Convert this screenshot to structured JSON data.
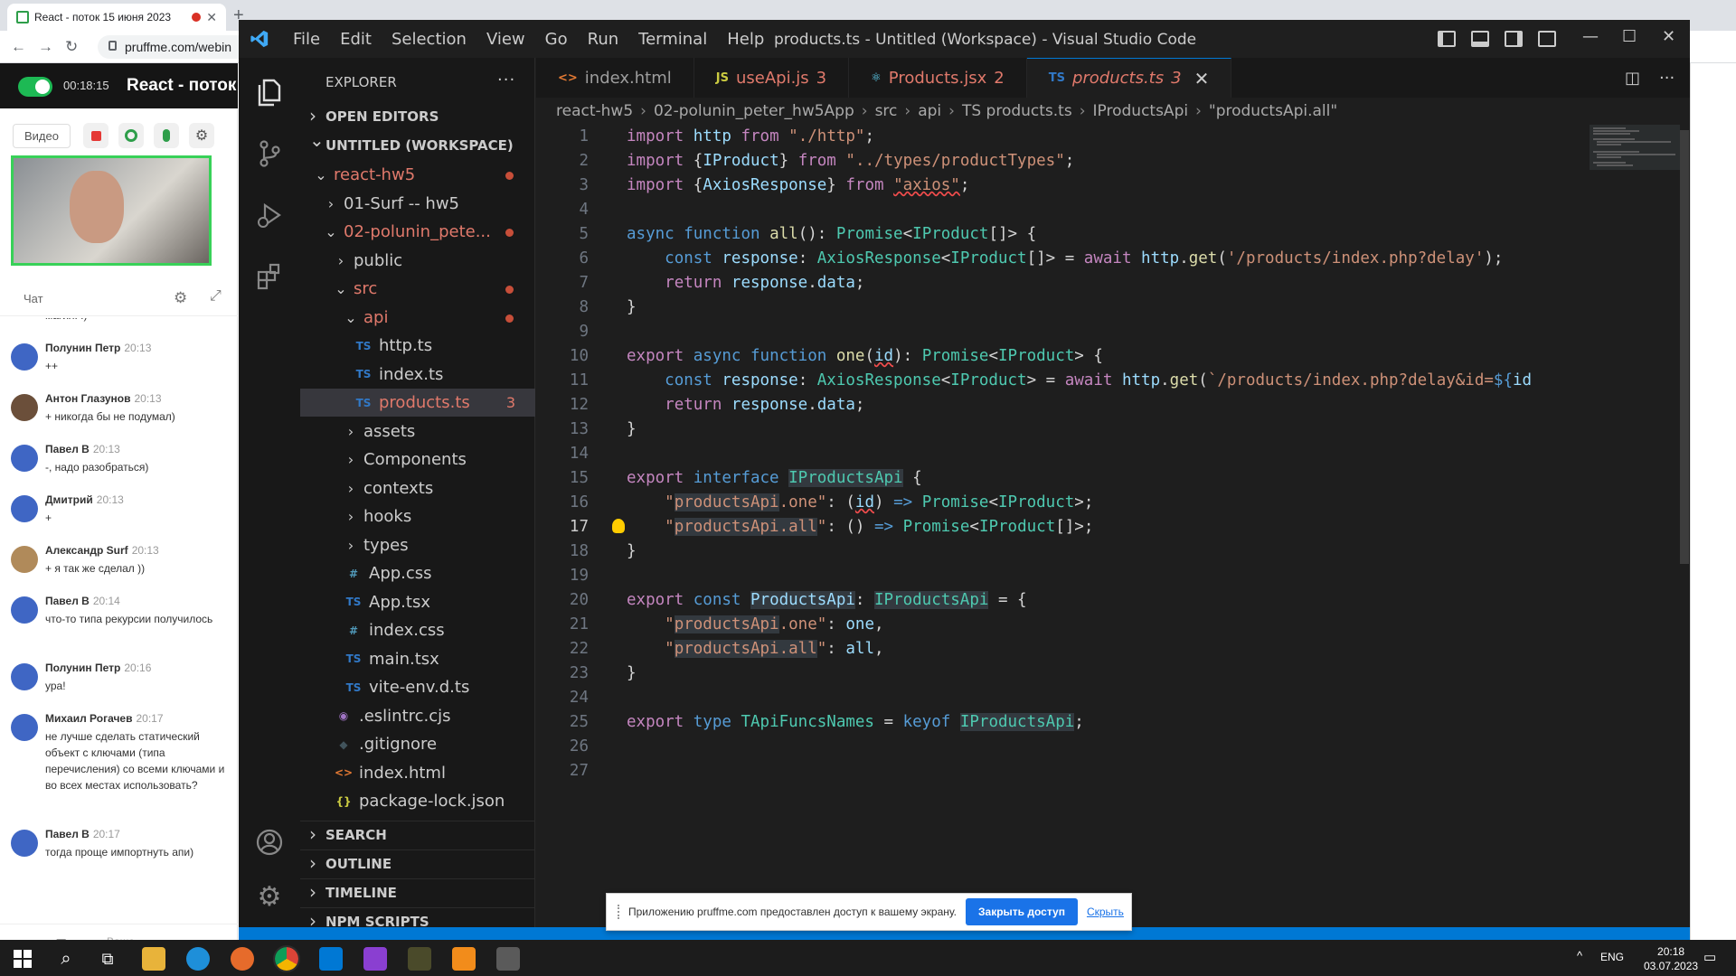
{
  "browser": {
    "tab_title": "React - поток 15 июня 2023",
    "url": "pruffme.com/webin"
  },
  "webinar": {
    "timer": "00:18:15",
    "title": "React - поток",
    "video_label": "Видео",
    "chat_tab": "Чат",
    "input_placeholder": "Ваше сообщение...",
    "messages": [
      {
        "name": "",
        "time": "",
        "text": "магия! :)"
      },
      {
        "name": "Полунин Петр",
        "time": "20:13",
        "text": "++"
      },
      {
        "name": "Антон Глазунов",
        "time": "20:13",
        "text": "+ никогда бы не подумал)"
      },
      {
        "name": "Павел В",
        "time": "20:13",
        "text": "-, надо разобраться)"
      },
      {
        "name": "Дмитрий",
        "time": "20:13",
        "text": "+"
      },
      {
        "name": "Александр Surf",
        "time": "20:13",
        "text": "+ я так же сделал ))"
      },
      {
        "name": "Павел В",
        "time": "20:14",
        "text": "что-то типа рекурсии получилось"
      },
      {
        "name": "Полунин Петр",
        "time": "20:16",
        "text": "ура!"
      },
      {
        "name": "Михаил Рогачев",
        "time": "20:17",
        "text": "не лучше сделать статический объект с ключами (типа перечисления) со всеми ключами и во всех местах использовать?"
      },
      {
        "name": "Павел В",
        "time": "20:17",
        "text": "тогда проще импортнуть апи)"
      }
    ]
  },
  "vscode": {
    "menu": [
      "File",
      "Edit",
      "Selection",
      "View",
      "Go",
      "Run",
      "Terminal",
      "Help"
    ],
    "window_title": "products.ts - Untitled (Workspace) - Visual Studio Code",
    "explorer_title": "EXPLORER",
    "sections": {
      "open_editors": "OPEN EDITORS",
      "workspace": "UNTITLED (WORKSPACE)",
      "search": "SEARCH",
      "outline": "OUTLINE",
      "timeline": "TIMELINE",
      "npm": "NPM SCRIPTS"
    },
    "tree": [
      {
        "label": "react-hw5",
        "icon": "",
        "chev": "⌄",
        "indent": 1,
        "red": true,
        "dot": true
      },
      {
        "label": "01-Surf -- hw5",
        "icon": "",
        "chev": "›",
        "indent": 2
      },
      {
        "label": "02-polunin_pete...",
        "icon": "",
        "chev": "⌄",
        "indent": 2,
        "red": true,
        "dot": true
      },
      {
        "label": "public",
        "icon": "",
        "chev": "›",
        "indent": 3
      },
      {
        "label": "src",
        "icon": "",
        "chev": "⌄",
        "indent": 3,
        "red": true,
        "dot": true
      },
      {
        "label": "api",
        "icon": "",
        "chev": "⌄",
        "indent": 4,
        "red": true,
        "dot": true
      },
      {
        "label": "http.ts",
        "icon": "TS",
        "indent": 5
      },
      {
        "label": "index.ts",
        "icon": "TS",
        "indent": 5
      },
      {
        "label": "products.ts",
        "icon": "TS",
        "indent": 5,
        "red": true,
        "count": "3",
        "selected": true
      },
      {
        "label": "assets",
        "icon": "",
        "chev": "›",
        "indent": 4
      },
      {
        "label": "Components",
        "icon": "",
        "chev": "›",
        "indent": 4
      },
      {
        "label": "contexts",
        "icon": "",
        "chev": "›",
        "indent": 4
      },
      {
        "label": "hooks",
        "icon": "",
        "chev": "›",
        "indent": 4
      },
      {
        "label": "types",
        "icon": "",
        "chev": "›",
        "indent": 4
      },
      {
        "label": "App.css",
        "icon": "#",
        "indent": 4
      },
      {
        "label": "App.tsx",
        "icon": "TS",
        "indent": 4
      },
      {
        "label": "index.css",
        "icon": "#",
        "indent": 4
      },
      {
        "label": "main.tsx",
        "icon": "TS",
        "indent": 4
      },
      {
        "label": "vite-env.d.ts",
        "icon": "TS",
        "indent": 4
      },
      {
        "label": ".eslintrc.cjs",
        "icon": "◉",
        "indent": 3
      },
      {
        "label": ".gitignore",
        "icon": "◆",
        "indent": 3
      },
      {
        "label": "index.html",
        "icon": "<>",
        "indent": 3
      },
      {
        "label": "package-lock.json",
        "icon": "{}",
        "indent": 3
      }
    ],
    "tabs": [
      {
        "label": "index.html",
        "icon": "<>",
        "count": ""
      },
      {
        "label": "useApi.js",
        "icon": "JS",
        "count": "3"
      },
      {
        "label": "Products.jsx",
        "icon": "⚛",
        "count": "2"
      },
      {
        "label": "products.ts",
        "icon": "TS",
        "count": "3",
        "active": true
      }
    ],
    "breadcrumb": [
      "react-hw5",
      "02-polunin_peter_hw5App",
      "src",
      "api",
      "TS products.ts",
      "IProductsApi",
      "\"productsApi.all\""
    ],
    "current_line": 17,
    "line_count": 27
  },
  "share_notice": {
    "text": "Приложению pruffme.com предоставлен доступ к вашему экрану.",
    "button": "Закрыть доступ",
    "link": "Скрыть"
  },
  "taskbar": {
    "lang": "ENG",
    "time": "20:18",
    "date": "03.07.2023"
  },
  "colors": {
    "vscode_bg": "#1e1e1e",
    "status_blue": "#0078d4",
    "error_red": "#e0796b",
    "share_blue": "#1a73e8"
  }
}
